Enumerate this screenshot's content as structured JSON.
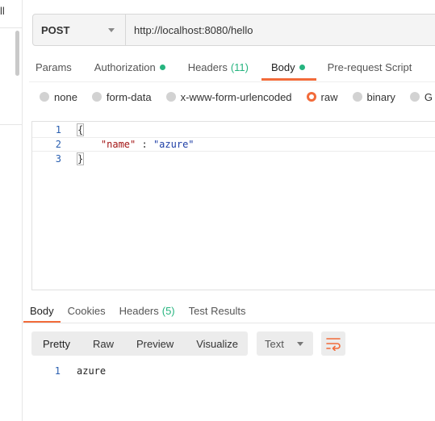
{
  "sidebar": {
    "cut_text": "ll"
  },
  "request": {
    "method": "POST",
    "url": "http://localhost:8080/hello"
  },
  "request_tabs": [
    {
      "label": "Params"
    },
    {
      "label": "Authorization",
      "dot": true
    },
    {
      "label": "Headers",
      "count": "(11)"
    },
    {
      "label": "Body",
      "dot": true,
      "active": true
    },
    {
      "label": "Pre-request Script"
    }
  ],
  "body_types": [
    {
      "label": "none"
    },
    {
      "label": "form-data"
    },
    {
      "label": "x-www-form-urlencoded"
    },
    {
      "label": "raw",
      "selected": true
    },
    {
      "label": "binary"
    },
    {
      "label": "G"
    }
  ],
  "editor": {
    "lines": [
      {
        "num": "1",
        "text": "{"
      },
      {
        "num": "2",
        "key": "\"name\"",
        "sep": " : ",
        "value": "\"azure\""
      },
      {
        "num": "3",
        "text": "}"
      }
    ]
  },
  "response_tabs": [
    {
      "label": "Body",
      "active": true
    },
    {
      "label": "Cookies"
    },
    {
      "label": "Headers",
      "count": "(5)"
    },
    {
      "label": "Test Results"
    }
  ],
  "response_toolbar": {
    "formats": [
      "Pretty",
      "Raw",
      "Preview",
      "Visualize"
    ],
    "active_format": "Pretty",
    "language": "Text"
  },
  "response_body": [
    {
      "num": "1",
      "text": "azure"
    }
  ],
  "colors": {
    "accent": "#f26b3a",
    "status_dot": "#26b47f",
    "line_number": "#2a5fb0",
    "json_key": "#a31515",
    "json_string": "#1f3fa6"
  },
  "icons": {
    "method_dropdown": "chevron-down-icon",
    "language_dropdown": "chevron-down-icon",
    "wrap": "wrap-lines-icon"
  }
}
